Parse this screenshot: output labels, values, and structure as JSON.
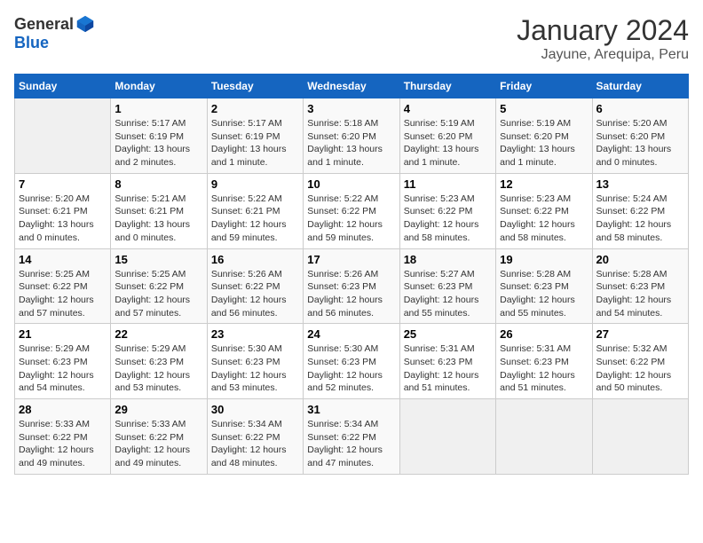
{
  "header": {
    "logo_general": "General",
    "logo_blue": "Blue",
    "title": "January 2024",
    "subtitle": "Jayune, Arequipa, Peru"
  },
  "days_of_week": [
    "Sunday",
    "Monday",
    "Tuesday",
    "Wednesday",
    "Thursday",
    "Friday",
    "Saturday"
  ],
  "weeks": [
    [
      {
        "day": "",
        "info": ""
      },
      {
        "day": "1",
        "info": "Sunrise: 5:17 AM\nSunset: 6:19 PM\nDaylight: 13 hours\nand 2 minutes."
      },
      {
        "day": "2",
        "info": "Sunrise: 5:17 AM\nSunset: 6:19 PM\nDaylight: 13 hours\nand 1 minute."
      },
      {
        "day": "3",
        "info": "Sunrise: 5:18 AM\nSunset: 6:20 PM\nDaylight: 13 hours\nand 1 minute."
      },
      {
        "day": "4",
        "info": "Sunrise: 5:19 AM\nSunset: 6:20 PM\nDaylight: 13 hours\nand 1 minute."
      },
      {
        "day": "5",
        "info": "Sunrise: 5:19 AM\nSunset: 6:20 PM\nDaylight: 13 hours\nand 1 minute."
      },
      {
        "day": "6",
        "info": "Sunrise: 5:20 AM\nSunset: 6:20 PM\nDaylight: 13 hours\nand 0 minutes."
      }
    ],
    [
      {
        "day": "7",
        "info": "Sunrise: 5:20 AM\nSunset: 6:21 PM\nDaylight: 13 hours\nand 0 minutes."
      },
      {
        "day": "8",
        "info": "Sunrise: 5:21 AM\nSunset: 6:21 PM\nDaylight: 13 hours\nand 0 minutes."
      },
      {
        "day": "9",
        "info": "Sunrise: 5:22 AM\nSunset: 6:21 PM\nDaylight: 12 hours\nand 59 minutes."
      },
      {
        "day": "10",
        "info": "Sunrise: 5:22 AM\nSunset: 6:22 PM\nDaylight: 12 hours\nand 59 minutes."
      },
      {
        "day": "11",
        "info": "Sunrise: 5:23 AM\nSunset: 6:22 PM\nDaylight: 12 hours\nand 58 minutes."
      },
      {
        "day": "12",
        "info": "Sunrise: 5:23 AM\nSunset: 6:22 PM\nDaylight: 12 hours\nand 58 minutes."
      },
      {
        "day": "13",
        "info": "Sunrise: 5:24 AM\nSunset: 6:22 PM\nDaylight: 12 hours\nand 58 minutes."
      }
    ],
    [
      {
        "day": "14",
        "info": "Sunrise: 5:25 AM\nSunset: 6:22 PM\nDaylight: 12 hours\nand 57 minutes."
      },
      {
        "day": "15",
        "info": "Sunrise: 5:25 AM\nSunset: 6:22 PM\nDaylight: 12 hours\nand 57 minutes."
      },
      {
        "day": "16",
        "info": "Sunrise: 5:26 AM\nSunset: 6:22 PM\nDaylight: 12 hours\nand 56 minutes."
      },
      {
        "day": "17",
        "info": "Sunrise: 5:26 AM\nSunset: 6:23 PM\nDaylight: 12 hours\nand 56 minutes."
      },
      {
        "day": "18",
        "info": "Sunrise: 5:27 AM\nSunset: 6:23 PM\nDaylight: 12 hours\nand 55 minutes."
      },
      {
        "day": "19",
        "info": "Sunrise: 5:28 AM\nSunset: 6:23 PM\nDaylight: 12 hours\nand 55 minutes."
      },
      {
        "day": "20",
        "info": "Sunrise: 5:28 AM\nSunset: 6:23 PM\nDaylight: 12 hours\nand 54 minutes."
      }
    ],
    [
      {
        "day": "21",
        "info": "Sunrise: 5:29 AM\nSunset: 6:23 PM\nDaylight: 12 hours\nand 54 minutes."
      },
      {
        "day": "22",
        "info": "Sunrise: 5:29 AM\nSunset: 6:23 PM\nDaylight: 12 hours\nand 53 minutes."
      },
      {
        "day": "23",
        "info": "Sunrise: 5:30 AM\nSunset: 6:23 PM\nDaylight: 12 hours\nand 53 minutes."
      },
      {
        "day": "24",
        "info": "Sunrise: 5:30 AM\nSunset: 6:23 PM\nDaylight: 12 hours\nand 52 minutes."
      },
      {
        "day": "25",
        "info": "Sunrise: 5:31 AM\nSunset: 6:23 PM\nDaylight: 12 hours\nand 51 minutes."
      },
      {
        "day": "26",
        "info": "Sunrise: 5:31 AM\nSunset: 6:23 PM\nDaylight: 12 hours\nand 51 minutes."
      },
      {
        "day": "27",
        "info": "Sunrise: 5:32 AM\nSunset: 6:22 PM\nDaylight: 12 hours\nand 50 minutes."
      }
    ],
    [
      {
        "day": "28",
        "info": "Sunrise: 5:33 AM\nSunset: 6:22 PM\nDaylight: 12 hours\nand 49 minutes."
      },
      {
        "day": "29",
        "info": "Sunrise: 5:33 AM\nSunset: 6:22 PM\nDaylight: 12 hours\nand 49 minutes."
      },
      {
        "day": "30",
        "info": "Sunrise: 5:34 AM\nSunset: 6:22 PM\nDaylight: 12 hours\nand 48 minutes."
      },
      {
        "day": "31",
        "info": "Sunrise: 5:34 AM\nSunset: 6:22 PM\nDaylight: 12 hours\nand 47 minutes."
      },
      {
        "day": "",
        "info": ""
      },
      {
        "day": "",
        "info": ""
      },
      {
        "day": "",
        "info": ""
      }
    ]
  ]
}
